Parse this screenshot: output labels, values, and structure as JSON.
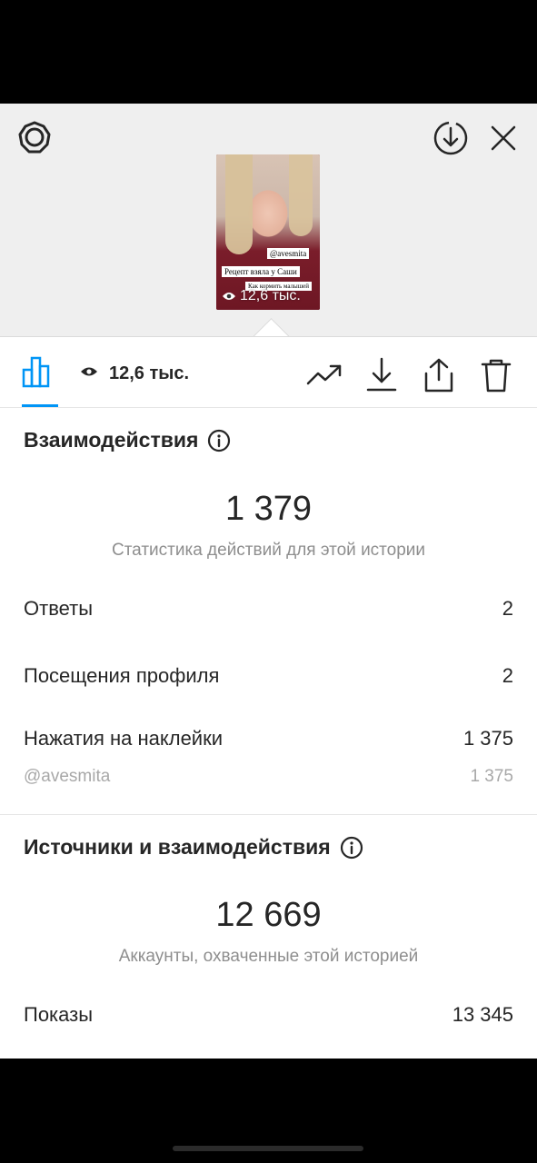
{
  "story": {
    "thumb_tags": [
      "@avesmita",
      "Рецепт взяла у Саши",
      "Как кормить малышей"
    ],
    "thumb_views": "12,6 тыс."
  },
  "toolbar": {
    "views": "12,6 тыс."
  },
  "interactions": {
    "title": "Взаимодействия",
    "total": "1 379",
    "caption": "Статистика действий для этой истории",
    "rows": [
      {
        "label": "Ответы",
        "value": "2"
      },
      {
        "label": "Посещения профиля",
        "value": "2"
      },
      {
        "label": "Нажатия на наклейки",
        "value": "1 375"
      }
    ],
    "sub_row": {
      "label": "@avesmita",
      "value": "1 375"
    }
  },
  "discovery": {
    "title": "Источники и взаимодействия",
    "total": "12 669",
    "caption": "Аккаунты, охваченные этой историей",
    "rows": [
      {
        "label": "Показы",
        "value": "13 345"
      }
    ]
  },
  "colors": {
    "accent": "#0095f6",
    "text": "#262626",
    "muted": "#8e8e8e",
    "preview_bg": "#efefef"
  }
}
